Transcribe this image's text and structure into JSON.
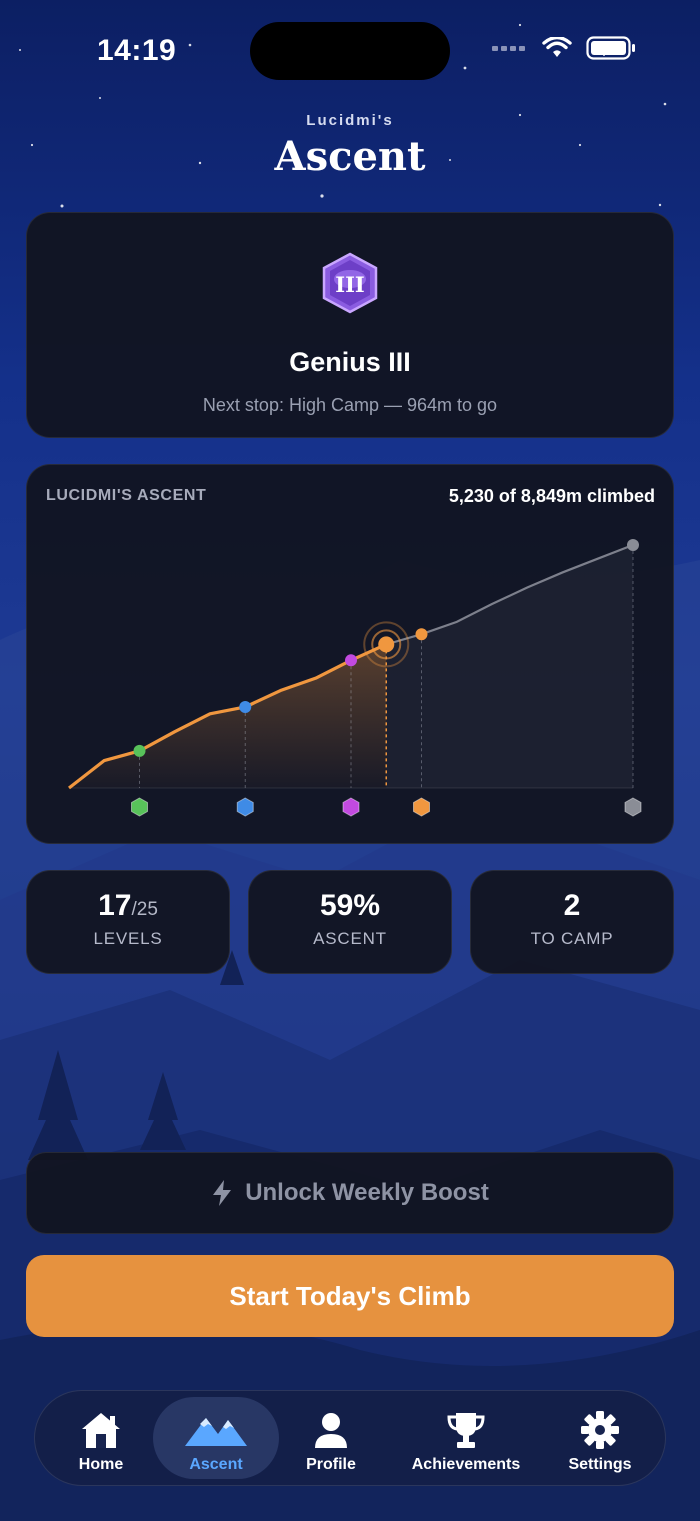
{
  "status": {
    "time": "14:19"
  },
  "header": {
    "subtitle": "Lucidmi's",
    "title": "Ascent"
  },
  "rank": {
    "badge_text": "III",
    "name": "Genius III",
    "next_stop": "Next stop: High Camp — 964m to go"
  },
  "chart_data": {
    "type": "line",
    "title": "LUCIDMI'S ASCENT",
    "progress_text": "5,230 of 8,849m climbed",
    "x": [
      0,
      1,
      2,
      3,
      4,
      5,
      6,
      7,
      8,
      9,
      10,
      11,
      12,
      13,
      14,
      15,
      16
    ],
    "y": [
      0,
      1000,
      1350,
      2050,
      2700,
      2950,
      3550,
      4000,
      4650,
      5230,
      5600,
      6050,
      6700,
      7300,
      7850,
      8350,
      8849
    ],
    "climbed_index": 9,
    "camps": [
      {
        "x": 2,
        "y": 1350,
        "color": "#58c25a",
        "icon": "green-camp-icon"
      },
      {
        "x": 5,
        "y": 2950,
        "color": "#3f8be6",
        "icon": "blue-camp-icon"
      },
      {
        "x": 8,
        "y": 4650,
        "color": "#c24ae0",
        "icon": "orange-camp-icon"
      },
      {
        "x": 10,
        "y": 5600,
        "color": "#f0973f",
        "icon": "purple-camp-icon"
      },
      {
        "x": 16,
        "y": 8849,
        "color": "#8a8d96",
        "icon": "gray-summit-icon"
      }
    ],
    "ylim": [
      0,
      8849
    ],
    "colors": {
      "climbed": "#f0973f",
      "remaining": "#7d808c"
    }
  },
  "stats": [
    {
      "value": "17",
      "suffix": "/25",
      "label": "LEVELS"
    },
    {
      "value": "59%",
      "suffix": "",
      "label": "ASCENT"
    },
    {
      "value": "2",
      "suffix": "",
      "label": "TO CAMP"
    }
  ],
  "boost": {
    "label": "Unlock Weekly Boost"
  },
  "cta": {
    "label": "Start Today's Climb"
  },
  "tabs": [
    {
      "label": "Home",
      "icon": "home-icon"
    },
    {
      "label": "Ascent",
      "icon": "mountains-icon",
      "active": true
    },
    {
      "label": "Profile",
      "icon": "person-icon"
    },
    {
      "label": "Achievements",
      "icon": "trophy-icon"
    },
    {
      "label": "Settings",
      "icon": "gear-icon"
    }
  ],
  "colors": {
    "accent": "#e6923f",
    "active_tab": "#5aa7ff"
  }
}
